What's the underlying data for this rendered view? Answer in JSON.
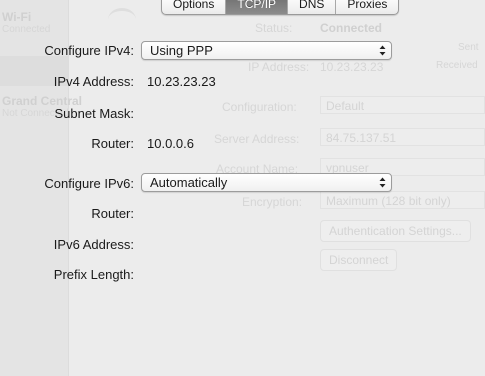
{
  "tabs": [
    {
      "label": "Options",
      "selected": false
    },
    {
      "label": "TCP/IP",
      "selected": true
    },
    {
      "label": "DNS",
      "selected": false
    },
    {
      "label": "Proxies",
      "selected": false
    }
  ],
  "ipv4": {
    "configure_label": "Configure IPv4:",
    "configure_value": "Using PPP",
    "address_label": "IPv4 Address:",
    "address_value": "10.23.23.23",
    "subnet_label": "Subnet Mask:",
    "subnet_value": "",
    "router_label": "Router:",
    "router_value": "10.0.0.6"
  },
  "ipv6": {
    "configure_label": "Configure IPv6:",
    "configure_value": "Automatically",
    "router_label": "Router:",
    "router_value": "",
    "address_label": "IPv6 Address:",
    "address_value": "",
    "prefix_label": "Prefix Length:",
    "prefix_value": ""
  },
  "background": {
    "sidebar_wifi": "Wi-Fi",
    "sidebar_wifi_status": "Connected",
    "sidebar_vpn": "Grand Central",
    "sidebar_vpn_status": "Not Connected",
    "status_label": "Status:",
    "status_value": "Connected",
    "ip_label": "IP Address:",
    "ip_value": "10.23.23.23",
    "sent_label": "Sent",
    "received_label": "Received",
    "configuration_label": "Configuration:",
    "configuration_value": "Default",
    "server_label": "Server Address:",
    "server_value": "84.75.137.51",
    "account_label": "Account Name:",
    "account_value": "vpnuser",
    "encryption_label": "Encryption:",
    "encryption_value": "Maximum (128 bit only)",
    "auth_button": "Authentication Settings...",
    "disconnect_button": "Disconnect"
  }
}
